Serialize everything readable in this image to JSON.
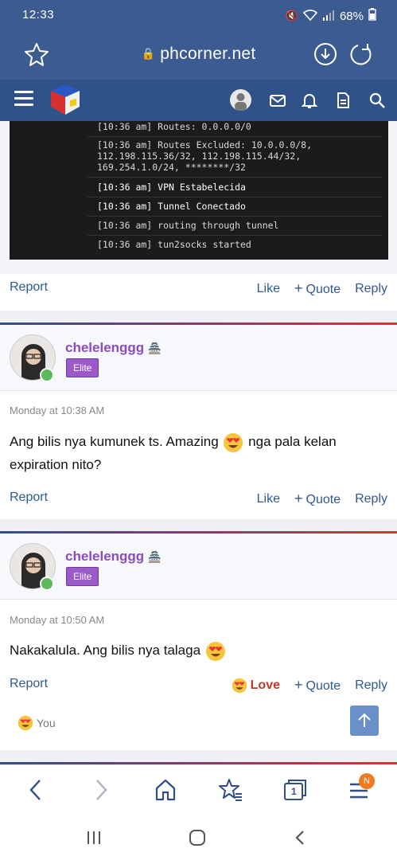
{
  "status_bar": {
    "time": "12:33",
    "battery": "68%"
  },
  "browser": {
    "url": "phcorner.net"
  },
  "code_lines": [
    "[10:36 am] Routes: 0.0.0.0/0",
    "[10:36 am] Routes Excluded: 10.0.0.0/8,",
    "112.198.115.36/32, 112.198.115.44/32,",
    "169.254.1.0/24, ********/32",
    "[10:36 am] VPN Estabelecida",
    "[10:36 am] Tunnel Conectado",
    "[10:36 am] routing through tunnel",
    "[10:36 am] tun2socks started"
  ],
  "actions": {
    "report": "Report",
    "like": "Like",
    "quote": "Quote",
    "reply": "Reply",
    "love": "Love"
  },
  "posts": [
    {
      "username": "chelelenggg",
      "badge": "Elite",
      "date": "Monday at 10:38 AM",
      "text_before": "Ang bilis nya kumunek ts. Amazing",
      "text_after": "nga pala kelan expiration nito?"
    },
    {
      "username": "chelelenggg",
      "badge": "Elite",
      "date": "Monday at 10:50 AM",
      "text_before": "Nakakalula. Ang bilis nya talaga",
      "text_after": ""
    }
  ],
  "reactions": {
    "you": "You"
  },
  "bottom_nav": {
    "tabs_count": "1",
    "notification_badge": "N"
  },
  "colors": {
    "header": "#2f5288",
    "browser": "#3c5b91",
    "link": "#2e5991",
    "username": "#8c4bbf",
    "badge": "#9b59c9",
    "love": "#c0392b"
  }
}
